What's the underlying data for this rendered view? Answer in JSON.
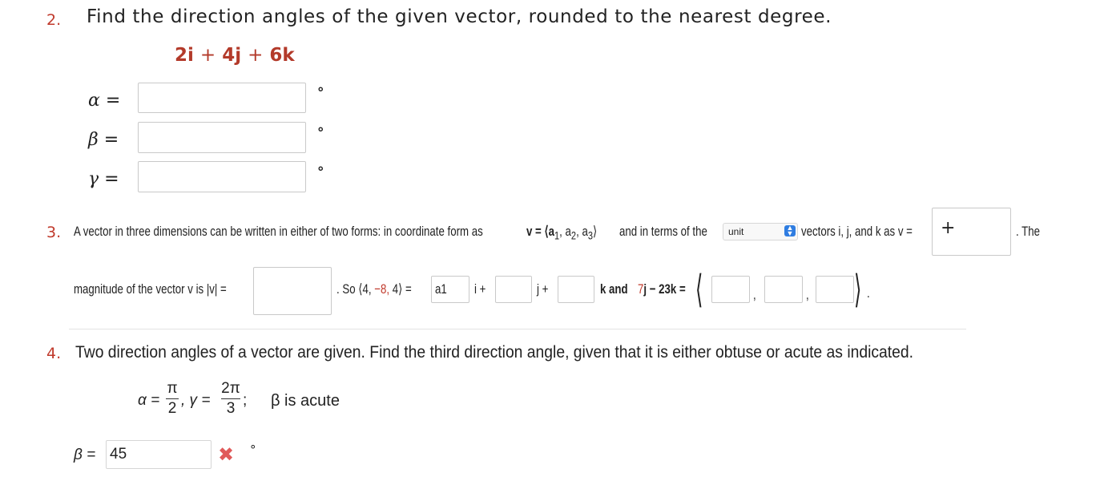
{
  "q2": {
    "number": "2.",
    "prompt": "Find the direction angles of the given vector, rounded to the nearest degree.",
    "vector": {
      "t1": "2i",
      "op1": "+",
      "t2": "4j",
      "op2": "+",
      "t3": "6k"
    },
    "rows": [
      {
        "symbol": "α",
        "eq": "=",
        "value": "",
        "unit": "°"
      },
      {
        "symbol": "β",
        "eq": "=",
        "value": "",
        "unit": "°"
      },
      {
        "symbol": "γ",
        "eq": "=",
        "value": "",
        "unit": "°"
      }
    ]
  },
  "q3": {
    "number": "3.",
    "line1_a": "A vector in three dimensions can be written in either of two forms: in coordinate form as",
    "v_eq": "v = ⟨a",
    "sub1": "1",
    "comma_a2": ", a",
    "sub2": "2",
    "comma_a3": ", a",
    "sub3": "3",
    "close": "⟩",
    "line1_b": "and in terms of the",
    "select_value": "unit",
    "line1_c": "vectors i, j, and k as v =",
    "plus_sign": "+",
    "line1_end": ". The",
    "line2_a": "magnitude of the vector v is |v| =",
    "line2_b": ". So ⟨4,",
    "neg8": "−8,",
    "four": "4⟩",
    "eq_sign": "=",
    "a1_value": "a1",
    "i_plus": "i +",
    "j_plus": "j +",
    "k_and": "k and",
    "seven": "7",
    "j_minus": "j − 23k =",
    "comma": ",",
    "period": "."
  },
  "q4": {
    "number": "4.",
    "prompt": "Two direction angles of a vector are given. Find the third direction angle, given that it is either obtuse or acute as indicated.",
    "alpha_label": "α =",
    "alpha_num": "π",
    "alpha_den": "2",
    "gamma_label": ", γ =",
    "gamma_num": "2π",
    "gamma_den": "3",
    "semicolon": ";",
    "condition": "β is acute",
    "answer_label": "β =",
    "answer_value": "45",
    "incorrect_icon": "x-mark-icon",
    "degree": "°"
  },
  "colors": {
    "accent_red": "#c0392b",
    "error_red": "#e05a5a",
    "select_blue": "#2f7de1"
  }
}
